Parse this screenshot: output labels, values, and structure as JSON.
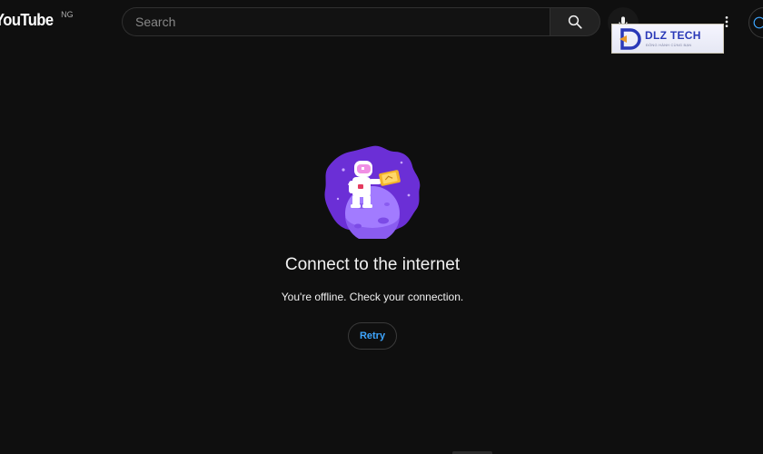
{
  "header": {
    "logo": {
      "text": "YouTube",
      "country": "NG"
    },
    "search": {
      "placeholder": "Search"
    },
    "icons": {
      "search": "search-icon",
      "mic": "microphone-icon",
      "more": "more-vert-icon",
      "account": "account-icon"
    }
  },
  "watermark": {
    "title": "DLZ TECH",
    "subtitle": "ĐỒNG HÀNH CÙNG BẠN",
    "brand_color": "#2a39b8"
  },
  "offline": {
    "title": "Connect to the internet",
    "message": "You're offline. Check your connection.",
    "retry_label": "Retry",
    "illustration": "astronaut-on-planet-illustration"
  },
  "colors": {
    "background": "#0f0f0f",
    "text": "#f1f1f1",
    "link_blue": "#3ea6ff",
    "illustration_purple": "#6b2fd6"
  }
}
